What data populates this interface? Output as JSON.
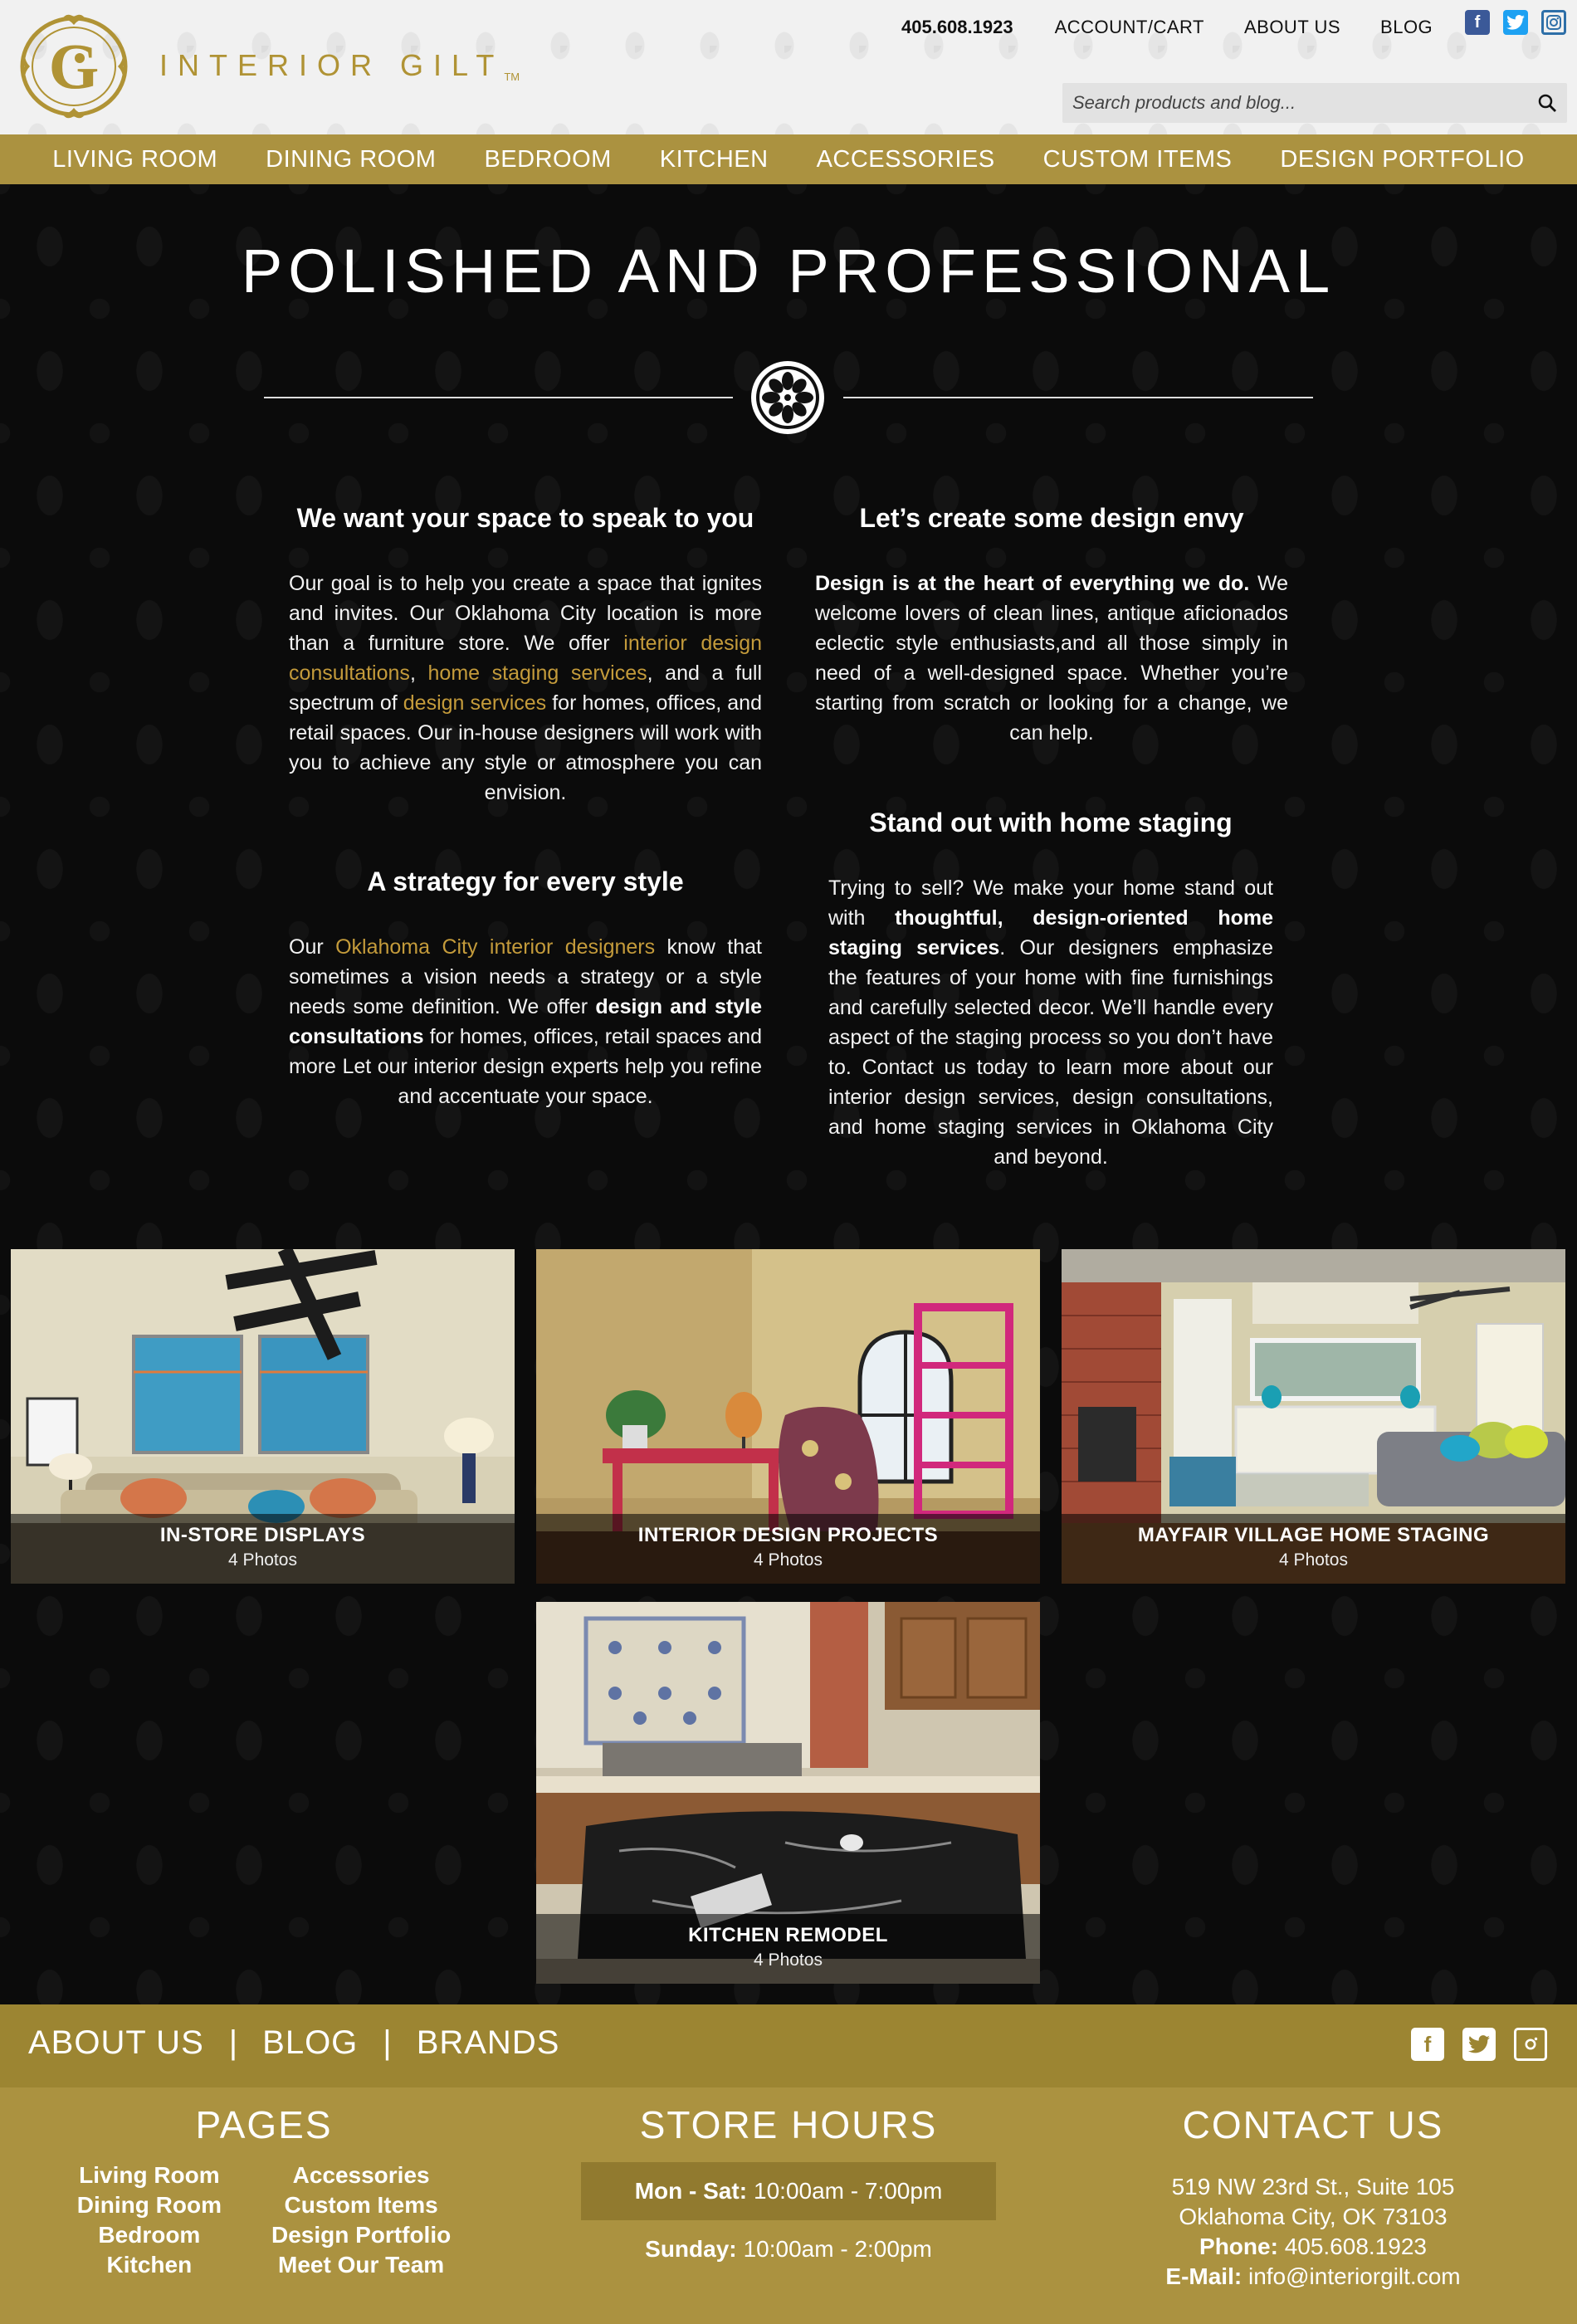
{
  "header": {
    "brand_word": "INTERIOR GILT",
    "brand_tm": "TM",
    "phone": "405.608.1923",
    "links": [
      "ACCOUNT/CART",
      "ABOUT US",
      "BLOG"
    ],
    "social": {
      "facebook": "f",
      "twitter": "t",
      "instagram": "◎"
    },
    "search_placeholder": "Search products and blog..."
  },
  "mainnav": [
    "LIVING ROOM",
    "DINING ROOM",
    "BEDROOM",
    "KITCHEN",
    "ACCESSORIES",
    "CUSTOM ITEMS",
    "DESIGN PORTFOLIO"
  ],
  "hero": {
    "title": "POLISHED AND PROFESSIONAL"
  },
  "sections": {
    "speak": {
      "heading": "We want your space to speak to you",
      "p1": "Our goal is to help you create a space that ignites and invites. Our Oklahoma City location is more than a furniture store. We offer ",
      "link1": "interior design consultations",
      "comma": ", ",
      "link2": "home staging services",
      "p2": ", and a full spectrum of ",
      "link3": "design services",
      "p3": " for homes, offices, and retail spaces. Our in-house designers will work with you to achieve any style or atmosphere you can envision."
    },
    "envy": {
      "heading": "Let’s create some design envy",
      "bold": "Design is at the heart of everything we do.",
      "text": " We welcome lovers of clean lines, antique aficionados eclectic style enthusiasts,and all those simply in need of a well-designed space. Whether you’re starting from scratch or looking for a change, we can help."
    },
    "strategy": {
      "heading": "A strategy for every style",
      "p1": "Our ",
      "link": "Oklahoma City interior designers",
      "p2": " know that sometimes a vision needs a strategy or a style needs some definition. We offer ",
      "bold": "design and style consultations",
      "p3": " for homes, offices, retail spaces and more Let our interior design experts help you refine and accentuate your space."
    },
    "staging": {
      "heading": "Stand out with home staging",
      "p1": "Trying to sell? We make your home stand out with ",
      "bold": "thoughtful, design-oriented home staging services",
      "p2": ". Our designers emphasize the features of your home with fine furnishings and carefully selected decor. We’ll handle every aspect of the staging process so you don’t have to. Contact us today to learn more about our interior design services, design consultations, and home staging services in Oklahoma City and beyond."
    }
  },
  "gallery": [
    {
      "title": "IN-STORE DISPLAYS",
      "count": "4 Photos"
    },
    {
      "title": "INTERIOR DESIGN PROJECTS",
      "count": "4 Photos"
    },
    {
      "title": "MAYFAIR VILLAGE HOME STAGING",
      "count": "4 Photos"
    },
    {
      "title": "KITCHEN REMODEL",
      "count": "4 Photos"
    }
  ],
  "footer": {
    "links": [
      "ABOUT US",
      "BLOG",
      "BRANDS"
    ],
    "separator": "|",
    "pages_title": "PAGES",
    "pages_col1": [
      "Living Room",
      "Dining Room",
      "Bedroom",
      "Kitchen"
    ],
    "pages_col2": [
      "Accessories",
      "Custom Items",
      "Design Portfolio",
      "Meet Our Team"
    ],
    "hours_title": "STORE HOURS",
    "hours": [
      {
        "label": "Mon - Sat:",
        "value": "10:00am - 7:00pm"
      },
      {
        "label": "Sunday:",
        "value": "10:00am - 2:00pm"
      }
    ],
    "contact_title": "CONTACT US",
    "address1": "519 NW 23rd St., Suite 105",
    "address2": "Oklahoma City, OK 73103",
    "phone_label": "Phone:",
    "phone": "405.608.1923",
    "email_label": "E-Mail:",
    "email": "info@interiorgilt.com"
  },
  "colors": {
    "gold": "#ab9240",
    "gold_dark": "#9c8532",
    "link_gold": "#c49b3b",
    "bg": "#0b0b0b"
  }
}
